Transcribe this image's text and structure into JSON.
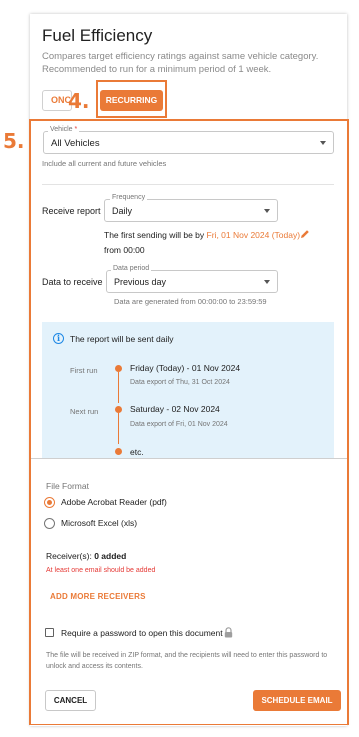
{
  "header": {
    "title": "Fuel Efficiency",
    "description": "Compares target efficiency ratings against same vehicle category. Recommended to run for a minimum period of 1 week."
  },
  "schedule_type": {
    "once_label": "ONCE",
    "recurring_label": "RECURRING"
  },
  "annotations": {
    "step4": "4.",
    "step5": "5."
  },
  "vehicle": {
    "label": "Vehicle",
    "required_mark": "*",
    "value": "All Vehicles",
    "hint": "Include all current and future vehicles"
  },
  "receive_report": {
    "label": "Receive report",
    "frequency_label": "Frequency",
    "frequency_value": "Daily",
    "first_sending_prefix": "The first sending will be by ",
    "first_sending_date": "Fri, 01 Nov 2024 (Today)",
    "from_time": "from 00:00"
  },
  "data_to_receive": {
    "label": "Data to receive",
    "period_label": "Data period",
    "period_value": "Previous day",
    "hint": "Data are generated from 00:00:00 to 23:59:59"
  },
  "info": {
    "title": "The report will be sent daily",
    "first_run_label": "First run",
    "first_run_title": "Friday (Today) - 01 Nov 2024",
    "first_run_sub": "Data export of Thu, 31 Oct 2024",
    "next_run_label": "Next run",
    "next_run_title": "Saturday - 02 Nov 2024",
    "next_run_sub": "Data export of Fri, 01 Nov 2024",
    "etc": "etc."
  },
  "file_format": {
    "label": "File Format",
    "options": [
      "Adobe Acrobat Reader (pdf)",
      "Microsoft Excel (xls)"
    ],
    "selected": "Adobe Acrobat Reader (pdf)"
  },
  "receivers": {
    "label": "Receiver(s):",
    "count": "0 added",
    "warning": "At least one email should be added",
    "add_label": "ADD MORE RECEIVERS"
  },
  "password": {
    "label": "Require a password to open this document",
    "checked": false,
    "note": "The file will be received in ZIP format, and the recipients will need to enter this password to unlock and access its contents."
  },
  "actions": {
    "cancel_label": "CANCEL",
    "schedule_label": "SCHEDULE EMAIL"
  },
  "colors": {
    "accent": "#ea7a37",
    "info_bg": "#e3f2fb",
    "error": "#e53935"
  }
}
